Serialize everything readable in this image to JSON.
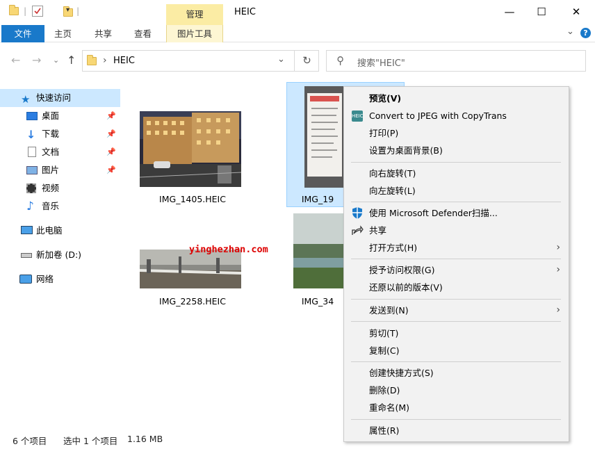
{
  "window": {
    "title": "HEIC",
    "manage_tab": "管理",
    "picture_tools": "图片工具",
    "minimize": "—",
    "maximize": "☐",
    "close": "✕"
  },
  "ribbon": {
    "tabs": [
      "文件",
      "主页",
      "共享",
      "查看"
    ],
    "expand": "⌄",
    "help": "?"
  },
  "nav": {
    "back": "←",
    "forward": "→",
    "up": "↑",
    "recent": "⌄",
    "path_sep": "›",
    "path": "HEIC",
    "path_dropdown": "⌄",
    "refresh": "↻",
    "search_icon": "⚲",
    "search_placeholder": "搜索\"HEIC\""
  },
  "sidebar": {
    "items": [
      {
        "label": "快速访问",
        "icon": "star-icon",
        "pinned": false
      },
      {
        "label": "桌面",
        "icon": "desktop-icon",
        "pinned": true
      },
      {
        "label": "下载",
        "icon": "download-icon",
        "pinned": true
      },
      {
        "label": "文档",
        "icon": "document-icon",
        "pinned": true
      },
      {
        "label": "图片",
        "icon": "pictures-icon",
        "pinned": true
      },
      {
        "label": "视频",
        "icon": "video-icon",
        "pinned": false
      },
      {
        "label": "音乐",
        "icon": "music-icon",
        "pinned": false
      },
      {
        "label": "此电脑",
        "icon": "computer-icon",
        "pinned": false
      },
      {
        "label": "新加卷 (D:)",
        "icon": "drive-icon",
        "pinned": false
      },
      {
        "label": "网络",
        "icon": "network-icon",
        "pinned": false
      }
    ]
  },
  "files": [
    {
      "name": "IMG_1405.HEIC"
    },
    {
      "name": "IMG_19"
    },
    {
      "name": "IMG_2258.HEIC"
    },
    {
      "name": "IMG_34"
    }
  ],
  "watermark": "yinghezhan.com",
  "status": {
    "count": "6 个项目",
    "selection": "选中 1 个项目",
    "size": "1.16 MB"
  },
  "context_menu": {
    "preview": "预览(V)",
    "convert": "Convert to JPEG with CopyTrans",
    "print": "打印(P)",
    "set_wallpaper": "设置为桌面背景(B)",
    "rotate_right": "向右旋转(T)",
    "rotate_left": "向左旋转(L)",
    "defender": "使用 Microsoft Defender扫描...",
    "share": "共享",
    "open_with": "打开方式(H)",
    "grant_access": "授予访问权限(G)",
    "restore": "还原以前的版本(V)",
    "send_to": "发送到(N)",
    "cut": "剪切(T)",
    "copy": "复制(C)",
    "create_shortcut": "创建快捷方式(S)",
    "delete": "删除(D)",
    "rename": "重命名(M)",
    "properties": "属性(R)",
    "submenu_arrow": "›"
  },
  "colors": {
    "accent": "#1979ca",
    "manage_tab_bg": "#fbeca4",
    "selection_bg": "#cce8ff",
    "menu_bg": "#f2f2f2",
    "watermark": "#dd0000"
  }
}
